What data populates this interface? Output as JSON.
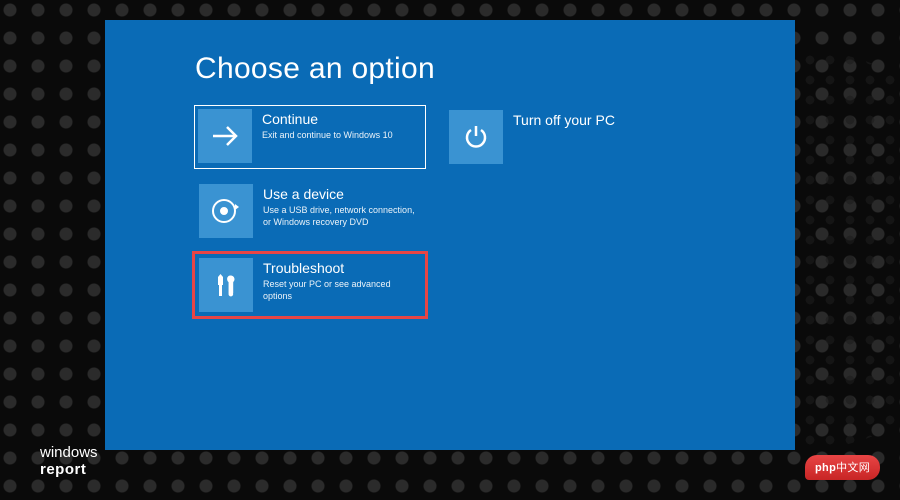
{
  "title": "Choose an option",
  "options": {
    "continue": {
      "label": "Continue",
      "desc": "Exit and continue to Windows 10"
    },
    "turnoff": {
      "label": "Turn off your PC",
      "desc": ""
    },
    "device": {
      "label": "Use a device",
      "desc": "Use a USB drive, network connection, or Windows recovery DVD"
    },
    "troubleshoot": {
      "label": "Troubleshoot",
      "desc": "Reset your PC or see advanced options"
    }
  },
  "watermarks": {
    "left_line1": "windows",
    "left_line2": "report",
    "right": "php中文网"
  },
  "colors": {
    "background": "#0a6bb6",
    "tile_icon_bg": "#3a93d2",
    "highlight": "#e84545"
  }
}
